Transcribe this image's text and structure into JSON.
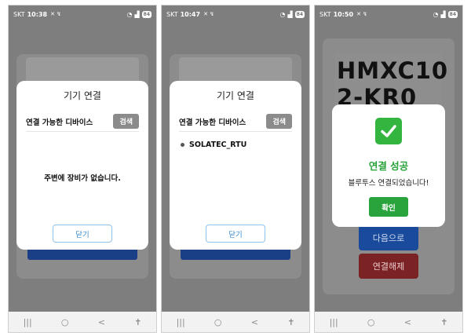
{
  "status_bar": {
    "carrier": "SKT",
    "left_icons": "✕ ↯",
    "battery": "84",
    "screen1_time": "10:38",
    "screen2_time": "10:47",
    "screen3_time": "10:50"
  },
  "device_dialog": {
    "title": "기기 연결",
    "available_label": "연결 가능한 디바이스",
    "search_label": "검색",
    "empty_message": "주변에 장비가 없습니다.",
    "close_label": "닫기"
  },
  "device_list": [
    {
      "name": "SOLATEC_RTU"
    }
  ],
  "screen3": {
    "model_line1": "HMXC10",
    "model_line2": "2-KR0",
    "next_label": "다음으로",
    "disconnect_label": "연결해제"
  },
  "success_dialog": {
    "title": "연결 성공",
    "message": "블루투스 연결되었습니다!",
    "confirm_label": "확인"
  },
  "nav_bar": {
    "recents": "|||",
    "home": "○",
    "back": "<",
    "accessibility": "✝"
  },
  "colors": {
    "primary_blue": "#1a4a9b",
    "danger_red": "#7a2224",
    "success_green": "#29a33b",
    "link_blue": "#3a8ed6"
  }
}
